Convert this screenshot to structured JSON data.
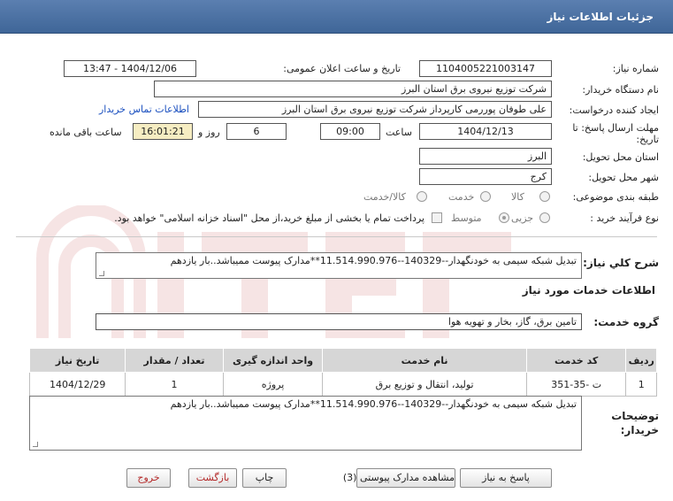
{
  "header": {
    "title": "جزئیات اطلاعات نیاز"
  },
  "fields": {
    "need_number_label": "شماره نیاز:",
    "need_number": "1104005221003147",
    "announce_label": "تاریخ و ساعت اعلان عمومی:",
    "announce_value": "1404/12/06 - 13:47",
    "buyer_org_label": "نام دستگاه خریدار:",
    "buyer_org": "شرکت توزیع نیروی برق استان البرز",
    "creator_label": "ایجاد کننده درخواست:",
    "creator": "علی طوفان پوررمی کارپرداز شرکت توزیع نیروی برق استان البرز",
    "contact_link": "اطلاعات تماس خریدار",
    "deadline_label_1": "مهلت ارسال پاسخ: تا",
    "deadline_label_2": "تاریخ:",
    "deadline_date": "1404/12/13",
    "time_label": "ساعت",
    "deadline_time": "09:00",
    "days_value": "6",
    "days_label": "روز و",
    "remaining_time": "16:01:21",
    "remaining_label": "ساعت باقی مانده",
    "province_label": "استان محل تحویل:",
    "province": "البرز",
    "city_label": "شهر محل تحویل:",
    "city": "کرج",
    "category_label": "طبقه بندی موضوعی:",
    "category_options": [
      "کالا",
      "خدمت",
      "کالا/خدمت"
    ],
    "process_label": "نوع فرآیند خرید :",
    "process_options": [
      "جزیی",
      "متوسط"
    ],
    "process_note": "پرداخت تمام یا بخشی از مبلغ خرید،از محل \"اسناد خزانه اسلامی\" خواهد بود."
  },
  "description": {
    "label": "شرح كلي نياز:",
    "text": "تبدیل شبکه سیمی به خودنگهدار--140329--11.514.990.976**مدارک پیوست ممیباشد..بار یازدهم"
  },
  "services": {
    "section_title": "اطلاعات خدمات مورد نیاز",
    "group_label": "گروه خدمت:",
    "group_value": "تامین برق، گاز، بخار و تهویه هوا",
    "columns": [
      "ردیف",
      "کد خدمت",
      "نام خدمت",
      "واحد اندازه گیری",
      "تعداد / مقدار",
      "تاریخ نیاز"
    ],
    "rows": [
      [
        "1",
        "ت -35-351",
        "تولید، انتقال و توزیع برق",
        "پروژه",
        "1",
        "1404/12/29"
      ]
    ]
  },
  "buyer_notes": {
    "label_1": "توضیحات",
    "label_2": "خریدار:",
    "text": "تبدیل شبکه سیمی به خودنگهدار--140329--11.514.990.976**مدارک پیوست ممیباشد..بار یازدهم"
  },
  "buttons": {
    "reply": "پاسخ به نیاز",
    "attachments": "مشاهده مدارک پیوستی (3)",
    "print": "چاپ",
    "back": "بازگشت",
    "exit": "خروج"
  }
}
